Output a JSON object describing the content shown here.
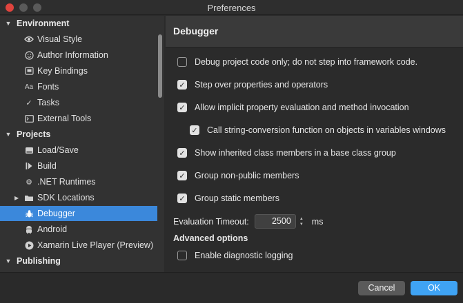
{
  "window": {
    "title": "Preferences"
  },
  "sidebar": {
    "categories": [
      {
        "label": "Environment"
      },
      {
        "label": "Projects"
      },
      {
        "label": "Publishing"
      }
    ],
    "environment_items": [
      {
        "label": "Visual Style",
        "icon": "eye-icon"
      },
      {
        "label": "Author Information",
        "icon": "smiley-icon"
      },
      {
        "label": "Key Bindings",
        "icon": "keyboard-icon"
      },
      {
        "label": "Fonts",
        "icon": "fonts-icon"
      },
      {
        "label": "Tasks",
        "icon": "checkmark-icon"
      },
      {
        "label": "External Tools",
        "icon": "terminal-icon"
      }
    ],
    "project_items": [
      {
        "label": "Load/Save",
        "icon": "drive-icon"
      },
      {
        "label": "Build",
        "icon": "build-icon"
      },
      {
        "label": ".NET Runtimes",
        "icon": "gear-icon"
      },
      {
        "label": "SDK Locations",
        "icon": "folder-icon"
      },
      {
        "label": "Debugger",
        "icon": "bug-icon",
        "selected": true
      },
      {
        "label": "Android",
        "icon": "android-icon"
      },
      {
        "label": "Xamarin Live Player (Preview)",
        "icon": "play-icon"
      }
    ]
  },
  "panel": {
    "title": "Debugger",
    "options": [
      {
        "label": "Debug project code only; do not step into framework code.",
        "checked": false
      },
      {
        "label": "Step over properties and operators",
        "checked": true
      },
      {
        "label": "Allow implicit property evaluation and method invocation",
        "checked": true
      },
      {
        "label": "Call string-conversion function on objects in variables windows",
        "checked": true
      },
      {
        "label": "Show inherited class members in a base class group",
        "checked": true
      },
      {
        "label": "Group non-public members",
        "checked": true
      },
      {
        "label": "Group static members",
        "checked": true
      }
    ],
    "timeout": {
      "label": "Evaluation Timeout:",
      "value": "2500",
      "unit": "ms"
    },
    "advanced": {
      "heading": "Advanced options",
      "options": [
        {
          "label": "Enable diagnostic logging",
          "checked": false
        }
      ]
    }
  },
  "footer": {
    "cancel_label": "Cancel",
    "ok_label": "OK"
  },
  "colors": {
    "accent": "#3b88db",
    "ok_button": "#3fa3f4"
  }
}
